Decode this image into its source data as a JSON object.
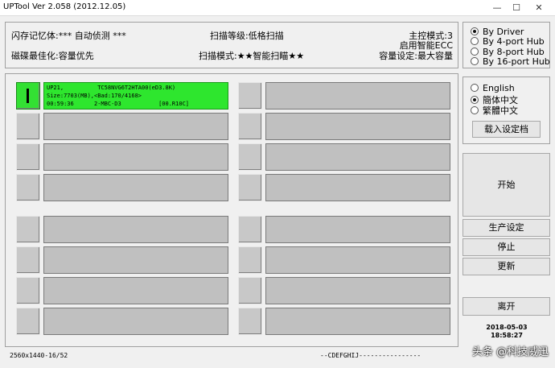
{
  "window": {
    "title": "UPTool Ver 2.058 (2012.12.05)",
    "controls": [
      "—",
      "☐",
      "✕"
    ]
  },
  "info": {
    "flash_info": "闪存记忆体:*** 自动侦测 ***",
    "scan_level": "扫描等级:低格扫描",
    "master_mode": "主控模式:3",
    "smart_ecc": "启用智能ECC",
    "disk_optimize": "磁碟最佳化:容量优先",
    "scan_mode": "扫描模式:★★智能扫瞄★★",
    "capacity_setting": "容量设定:最大容量"
  },
  "hub_options": {
    "items": [
      "By Driver",
      "By 4-port Hub",
      "By 8-port Hub",
      "By 16-port Hub"
    ],
    "selected": 0
  },
  "language_options": {
    "items": [
      "English",
      "簡体中文",
      "繁體中文"
    ],
    "selected": 1
  },
  "buttons": {
    "load_config": "载入设定档",
    "start": "开始",
    "production_settings": "生产设定",
    "stop": "停止",
    "update": "更新",
    "exit": "离开"
  },
  "active_slot": {
    "line1": "UP21,          TC58NVG6T2HTA00(eD3.8K)",
    "line2": "Size:7703(MB),<Bad:170/4168>",
    "line3": "00:59:36      2-MBC-D3           [00.R10C]"
  },
  "datetime": {
    "date": "2018-05-03",
    "time": "18:58:27"
  },
  "status_bar": {
    "resolution": "2560x1440-16/52",
    "drives": "--CDEFGHIJ----------------"
  },
  "watermark": "头条 @科技威迅",
  "colors": {
    "active_green": "#2ee62e",
    "slot_gray": "#c0c0c0",
    "background": "#f0f0f0"
  }
}
